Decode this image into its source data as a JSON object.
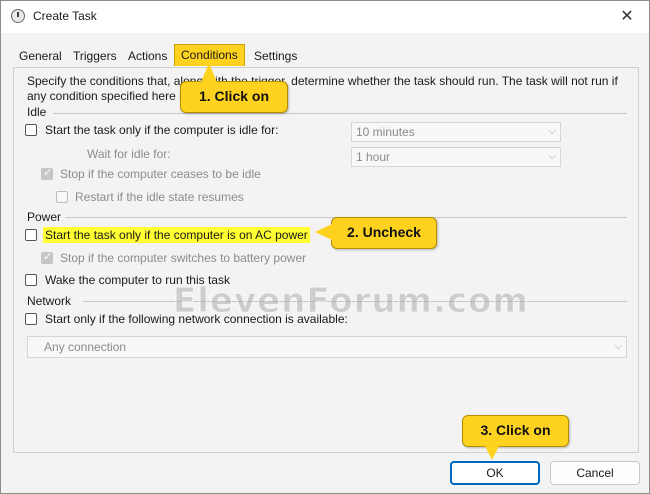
{
  "window": {
    "title": "Create Task",
    "close_glyph": "✕"
  },
  "tabs": [
    {
      "label": "General"
    },
    {
      "label": "Triggers"
    },
    {
      "label": "Actions"
    },
    {
      "label": "Conditions",
      "active": true
    },
    {
      "label": "Settings"
    }
  ],
  "description": "Specify the conditions that, along with the trigger, determine whether the task should run.  The task will not run  if any condition specified here is not true.",
  "idle": {
    "section_label": "Idle",
    "start_if_idle": {
      "label": "Start the task only if the computer is idle for:",
      "checked": false
    },
    "idle_for_value": "10 minutes",
    "wait_label": "Wait for idle for:",
    "wait_value": "1 hour",
    "stop_if_ceases": {
      "label": "Stop if the computer ceases to be idle",
      "checked": true,
      "disabled": true
    },
    "restart_if_resumes": {
      "label": "Restart if the idle state resumes",
      "checked": false,
      "disabled": true
    }
  },
  "power": {
    "section_label": "Power",
    "start_if_ac": {
      "label": "Start the task only if the computer is on AC power",
      "checked": false
    },
    "stop_if_battery": {
      "label": "Stop if the computer switches to battery power",
      "checked": true,
      "disabled": true
    },
    "wake_to_run": {
      "label": "Wake the computer to run this task",
      "checked": false
    }
  },
  "network": {
    "section_label": "Network",
    "start_if_network": {
      "label": "Start only if the following network connection is available:",
      "checked": false
    },
    "connection_value": "Any connection"
  },
  "callouts": {
    "step1": "1. Click on",
    "step2": "2. Uncheck",
    "step3": "3. Click on"
  },
  "buttons": {
    "ok": "OK",
    "cancel": "Cancel"
  },
  "watermark": "ElevenForum.com",
  "colors": {
    "highlight": "#ffd21f",
    "text_highlight": "#ffff33",
    "accent": "#0067c0"
  }
}
